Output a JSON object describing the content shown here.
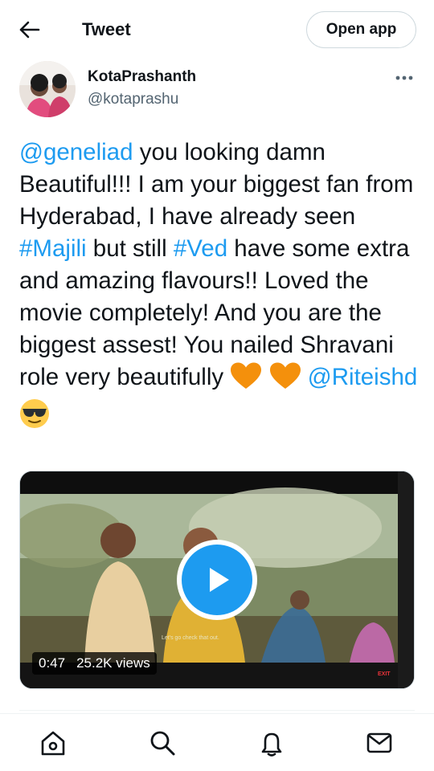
{
  "header": {
    "title": "Tweet",
    "open_app_label": "Open app",
    "back_icon": "arrow-left-icon"
  },
  "author": {
    "name": "KotaPrashanth",
    "handle": "@kotaprashu"
  },
  "tweet": {
    "seg1": "@geneliad",
    "seg2": " you looking damn Beautiful!!! I am your biggest fan from Hyderabad, I have already seen ",
    "seg3": "#Majili",
    "seg4": " but still ",
    "seg5": "#Ved",
    "seg6": " have some extra and amazing flavours!! Loved the movie completely! And you are the biggest assest! You nailed Shravani role very beautifully ",
    "seg7": "@Riteishd"
  },
  "media": {
    "duration": "0:47",
    "views": "25.2K views",
    "subtitle": "Let's go check that out.",
    "exit_sign": "EXIT"
  },
  "colors": {
    "link": "#1d9bf0",
    "text": "#0f1419",
    "secondary": "#536471",
    "heart": "#f4900c"
  },
  "nav": [
    "home-icon",
    "search-icon",
    "notifications-icon",
    "messages-icon"
  ]
}
